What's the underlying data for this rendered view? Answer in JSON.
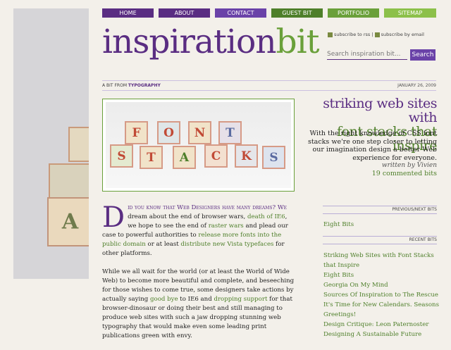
{
  "nav": {
    "items": [
      {
        "label": "HOME",
        "color": "#5a2d82"
      },
      {
        "label": "ABOUT",
        "color": "#5a2d82"
      },
      {
        "label": "CONTACT",
        "color": "#6a42a8"
      },
      {
        "label": "GUEST BIT",
        "color": "#4e7f2a"
      },
      {
        "label": "PORTFOLIO",
        "color": "#6aa03a"
      },
      {
        "label": "SITEMAP",
        "color": "#8cc04a"
      }
    ]
  },
  "logo": {
    "part1": "inspiration",
    "part2": "bit"
  },
  "subscribe": {
    "rss": "subscribe to rss",
    "email": "subscribe by email",
    "separator": "|"
  },
  "search": {
    "placeholder": "Search inspiration bit...",
    "button": "Search"
  },
  "post": {
    "category_prefix": "A BIT FROM",
    "category": "TYPOGRAPHY",
    "date": "JANUARY 26, 2009",
    "title_line1": "striking web sites with",
    "title_line2": "font stacks that inspire",
    "excerpt": "With the right knowledge of CSS font stacks we're one step closer to letting our imagination design a better Web experience for everyone.",
    "author": "written by Vivien",
    "comments": "19 commented bits",
    "image_letters_top": [
      "F",
      "O",
      "N",
      "T"
    ],
    "image_letters_bottom": [
      "S",
      "T",
      "A",
      "C",
      "K",
      "S"
    ],
    "body": {
      "dropcap": "D",
      "p1_sc": "id you know that Web Designers have many dreams? We",
      "p1_a": " dream about the end of browser wars, ",
      "p1_link1": "death of IE6",
      "p1_b": ", we hope to see the end of ",
      "p1_link2": "raster wars",
      "p1_c": " and plead our case to powerful authorities to ",
      "p1_link3": "release more fonts into the public domain",
      "p1_d": " or at least ",
      "p1_link4": "distribute new Vista typefaces",
      "p1_e": " for other platforms.",
      "p2_a": "While we all wait for the world (or at least the World of Wide Web) to become more beautiful and complete, and beseeching for those wishes to come true, some designers take actions by actually saying ",
      "p2_link1": "good bye",
      "p2_b": " to IE6 and ",
      "p2_link2": "dropping support",
      "p2_c": " for that browser-dinosaur or doing their best and still managing to produce web sites with such a jaw dropping stunning web typography that would make even some leading print publications green with envy."
    }
  },
  "sidebar": {
    "prevnext_title": "PREVIOUS/NEXT BITS",
    "prevnext_item": "Eight Bits",
    "recent_title": "RECENT BITS",
    "recent_items": [
      "Striking Web Sites with Font Stacks that Inspire",
      "Eight Bits",
      "Georgia On My Mind",
      "Sources Of Inspiration to The Rescue",
      "It's Time for New Calendars. Seasons Greetings!",
      "Design Critique: Leon Paternoster",
      "Designing A Sustainable Future"
    ]
  },
  "left_photo": {
    "letters": [
      "A"
    ]
  }
}
